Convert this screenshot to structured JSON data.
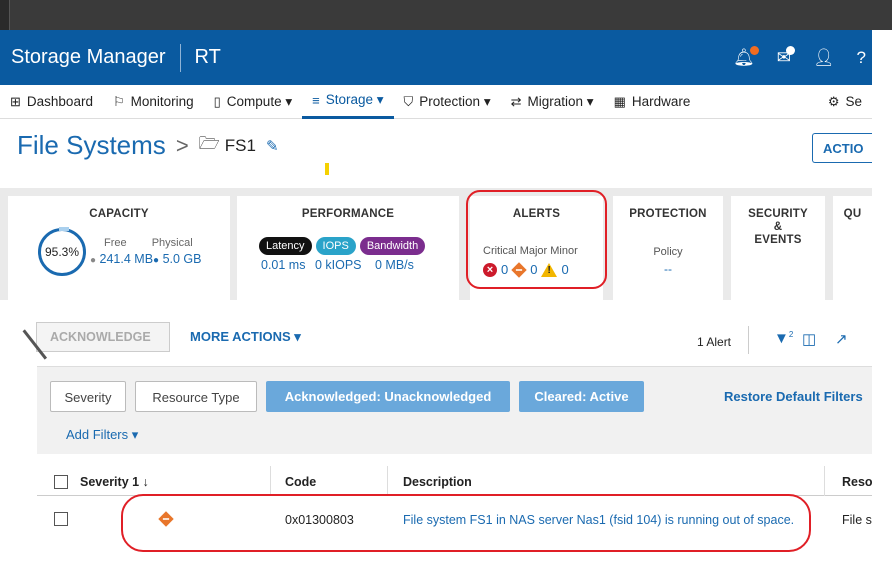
{
  "app": {
    "brand": "Storage Manager",
    "system": "RT",
    "header_icons": [
      {
        "name": "alerts-bell-icon",
        "dot_color": "#f26c21"
      },
      {
        "name": "messages-icon",
        "dot_color": "#ffffff"
      },
      {
        "name": "user-icon"
      },
      {
        "name": "help-icon"
      }
    ]
  },
  "nav": {
    "items": [
      {
        "label": "Dashboard",
        "icon": "dashboard-icon",
        "glyph": "⊞"
      },
      {
        "label": "Monitoring",
        "icon": "flag-icon",
        "glyph": "⚐"
      },
      {
        "label": "Compute ▾",
        "icon": "compute-icon",
        "glyph": "▯"
      },
      {
        "label": "Storage ▾",
        "icon": "storage-icon",
        "glyph": "≡",
        "active": true
      },
      {
        "label": "Protection ▾",
        "icon": "shield-icon",
        "glyph": "⛉"
      },
      {
        "label": "Migration ▾",
        "icon": "migration-icon",
        "glyph": "⇄"
      },
      {
        "label": "Hardware",
        "icon": "hardware-icon",
        "glyph": "▦"
      },
      {
        "label": "Se",
        "icon": "settings-icon",
        "glyph": "⚙"
      }
    ]
  },
  "page": {
    "title": "File Systems",
    "crumb_sep": ">",
    "crumb": "FS1",
    "action_label": "ACTIO"
  },
  "cards": {
    "capacity": {
      "title": "CAPACITY",
      "percent": "95.3%",
      "free_label": "Free",
      "physical_label": "Physical",
      "free_value": "241.4 MB",
      "physical_value": "5.0 GB"
    },
    "performance": {
      "title": "PERFORMANCE",
      "pills": [
        {
          "label": "Latency",
          "color": "#111111"
        },
        {
          "label": "IOPS",
          "color": "#2aa3c9"
        },
        {
          "label": "Bandwidth",
          "color": "#7b2d8e"
        }
      ],
      "latency": "0.01 ms",
      "iops": "0 kIOPS",
      "bandwidth": "0 MB/s"
    },
    "alerts": {
      "title": "ALERTS",
      "critical_label": "Critical",
      "major_label": "Major",
      "minor_label": "Minor",
      "critical_count": "0",
      "major_count": "0",
      "minor_count": "0"
    },
    "protection": {
      "title": "PROTECTION",
      "policy_label": "Policy",
      "policy_value": "--"
    },
    "security": {
      "title_line1": "SECURITY",
      "title_line2": "&",
      "title_line3": "EVENTS"
    },
    "quotas": {
      "title": "QU"
    }
  },
  "toolbar": {
    "acknowledge": "ACKNOWLEDGE",
    "more_actions": "MORE ACTIONS ▾",
    "alert_count": "1 Alert"
  },
  "filters": {
    "severity": "Severity",
    "resource_type": "Resource Type",
    "acknowledged": "Acknowledged: Unacknowledged",
    "cleared": "Cleared: Active",
    "restore": "Restore Default Filters",
    "add_filters": "Add Filters ▾"
  },
  "table": {
    "columns": {
      "severity": "Severity 1 ↓",
      "code": "Code",
      "description": "Description",
      "resource": "Reso"
    },
    "rows": [
      {
        "severity": "major",
        "code": "0x01300803",
        "description": "File system FS1 in NAS server Nas1 (fsid 104) is running out of space.",
        "resource": "File s"
      }
    ]
  },
  "colors": {
    "header_blue": "#0a5aa0",
    "link_blue": "#1a6ab0",
    "annotation_red": "#e01f26"
  }
}
